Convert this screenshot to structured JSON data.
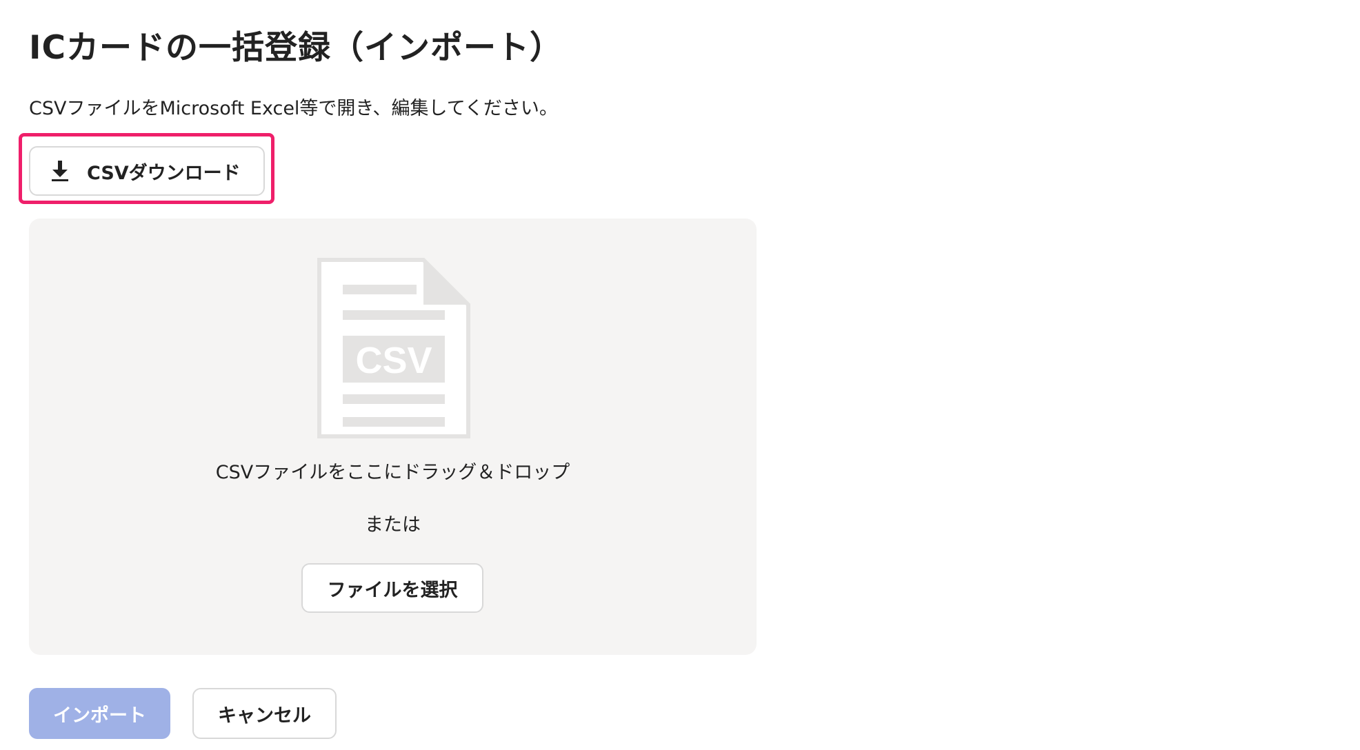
{
  "page": {
    "title": "ICカードの一括登録（インポート）",
    "instructions": "CSVファイルをMicrosoft Excel等で開き、編集してください。"
  },
  "download": {
    "label": "CSVダウンロード",
    "icon": "download-icon"
  },
  "drop_zone": {
    "file_icon": "csv-file-icon",
    "file_icon_label": "CSV",
    "instruction": "CSVファイルをここにドラッグ＆ドロップ",
    "or_text": "または",
    "select_label": "ファイルを選択"
  },
  "actions": {
    "import_label": "インポート",
    "import_disabled": true,
    "cancel_label": "キャンセル"
  },
  "colors": {
    "highlight": "#ef1f6a",
    "import_button_disabled": "#9fb1e6",
    "drop_zone_background": "#f5f4f3",
    "csv_icon": "#e4e3e2"
  }
}
